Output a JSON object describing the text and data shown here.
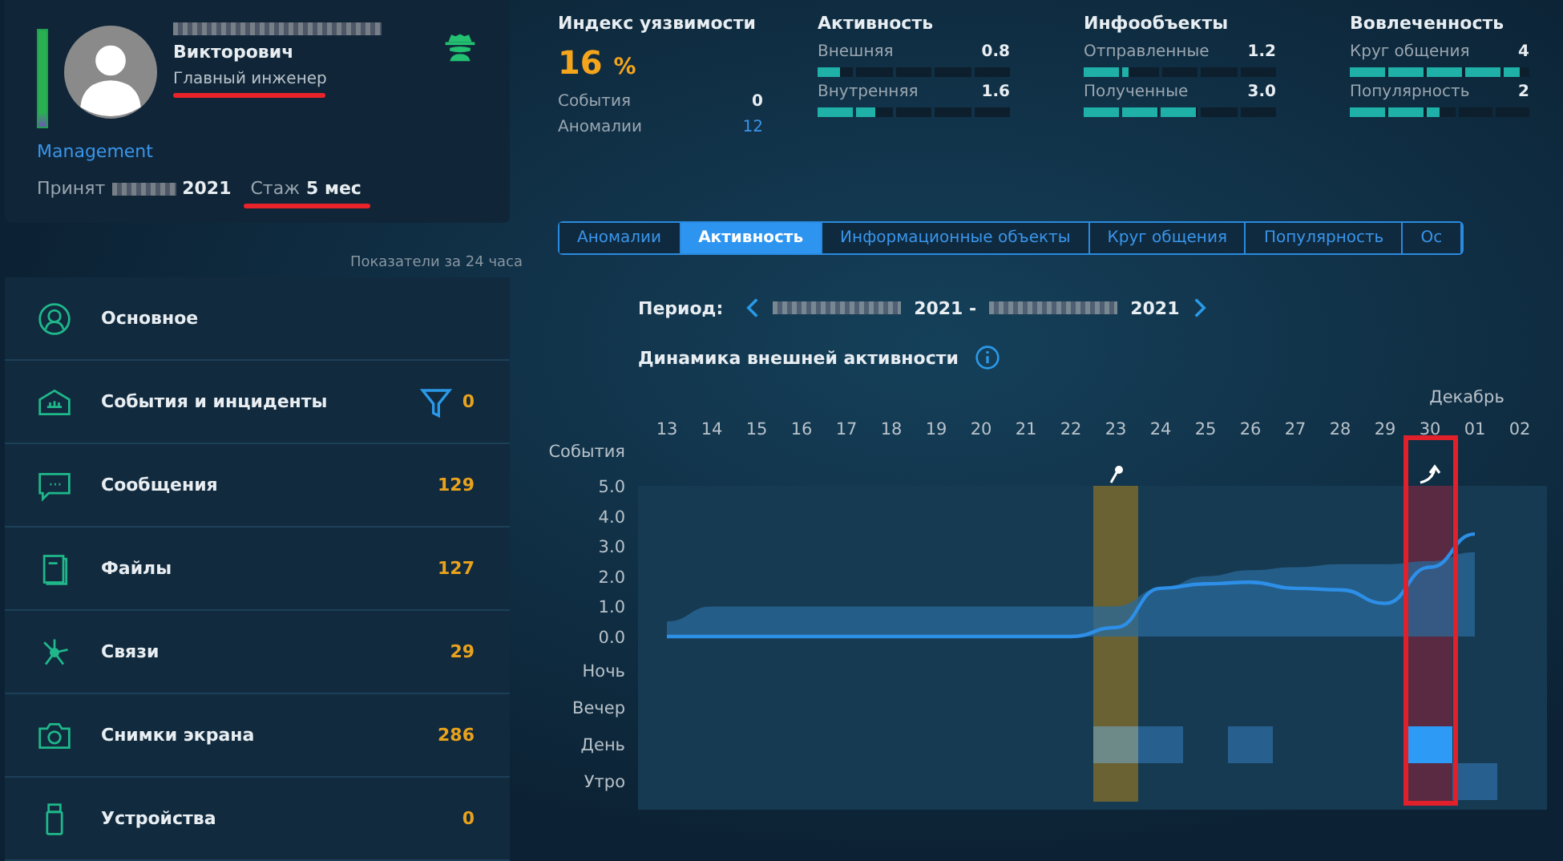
{
  "profile": {
    "name": "Викторович",
    "position": "Главный инженер",
    "department": "Management",
    "hired_label": "Принят",
    "hired_year": "2021",
    "tenure_label": "Стаж",
    "tenure_value": "5 мес"
  },
  "period_note": "Показатели за 24 часа",
  "sidebar": {
    "items": [
      {
        "kind": "person",
        "label": "Основное"
      },
      {
        "kind": "incidents",
        "label": "События и инциденты",
        "count": "0",
        "filter": true
      },
      {
        "kind": "messages",
        "label": "Сообщения",
        "count": "129"
      },
      {
        "kind": "files",
        "label": "Файлы",
        "count": "127"
      },
      {
        "kind": "links",
        "label": "Связи",
        "count": "29"
      },
      {
        "kind": "screenshots",
        "label": "Снимки экрана",
        "count": "286"
      },
      {
        "kind": "devices",
        "label": "Устройства",
        "count": "0"
      }
    ]
  },
  "vulnerability": {
    "title": "Индекс уязвимости",
    "value": "16",
    "unit": "%",
    "rows": [
      {
        "label": "События",
        "value": "0",
        "kind": "plain"
      },
      {
        "label": "Аномалии",
        "value": "12",
        "kind": "link"
      }
    ]
  },
  "metric_groups": [
    {
      "title": "Активность",
      "metrics": [
        {
          "label": "Внешняя",
          "value": "0.8",
          "level": 0.12
        },
        {
          "label": "Внутренняя",
          "value": "1.6",
          "level": 0.3
        }
      ]
    },
    {
      "title": "Инфообъекты",
      "metrics": [
        {
          "label": "Отправленные",
          "value": "1.2",
          "level": 0.23
        },
        {
          "label": "Полученные",
          "value": "3.0",
          "level": 0.6
        }
      ]
    },
    {
      "title": "Вовлеченность",
      "metrics": [
        {
          "label": "Круг общения",
          "value": "4",
          "level": 0.95
        },
        {
          "label": "Популярность",
          "value": "2",
          "level": 0.5
        }
      ]
    }
  ],
  "tabs": [
    {
      "label": "Аномалии",
      "selected": false
    },
    {
      "label": "Активность",
      "selected": true
    },
    {
      "label": "Информационные объекты",
      "selected": false
    },
    {
      "label": "Круг общения",
      "selected": false
    },
    {
      "label": "Популярность",
      "selected": false
    },
    {
      "label": "Ос",
      "selected": false
    }
  ],
  "period": {
    "label": "Период:",
    "start_year": "2021 -",
    "end_year": "2021"
  },
  "chart": {
    "title": "Динамика внешней активности",
    "month": "Декабрь",
    "row_labels": [
      "Ночь",
      "Вечер",
      "День",
      "Утро"
    ],
    "chart_data": {
      "type": "line",
      "ylabel": "События",
      "categories": [
        "13",
        "14",
        "15",
        "16",
        "17",
        "18",
        "19",
        "20",
        "21",
        "22",
        "23",
        "24",
        "25",
        "26",
        "27",
        "28",
        "29",
        "30",
        "01",
        "02"
      ],
      "yticks": [
        {
          "value": 0,
          "label": "0.0"
        },
        {
          "value": 1,
          "label": "1.0"
        },
        {
          "value": 2,
          "label": "2.0"
        },
        {
          "value": 3,
          "label": "3.0"
        },
        {
          "value": 4,
          "label": "4.0"
        },
        {
          "value": 5,
          "label": "5.0"
        }
      ],
      "ylim": [
        0,
        5
      ],
      "series": [
        {
          "type": "area",
          "color": "#2a6a9a",
          "values": [
            0.5,
            1.0,
            1.0,
            1.0,
            1.0,
            1.0,
            1.0,
            1.0,
            1.0,
            1.0,
            1.0,
            1.6,
            2.0,
            2.2,
            2.3,
            2.4,
            2.4,
            2.5,
            2.8,
            null
          ]
        },
        {
          "type": "line",
          "color": "#2d8fe8",
          "values": [
            0,
            0,
            0,
            0,
            0,
            0,
            0,
            0,
            0,
            0,
            0.3,
            1.6,
            1.75,
            1.8,
            1.6,
            1.55,
            1.1,
            2.3,
            3.4,
            null
          ]
        }
      ]
    },
    "columns": [
      {},
      {},
      {},
      {},
      {},
      {},
      {},
      {},
      {},
      {},
      {
        "highlight": {
          "kind": "star",
          "color": "#6a6233"
        },
        "cells": [
          null,
          null,
          {
            "color": "#6e8a88"
          },
          null
        ]
      },
      {
        "cells": [
          null,
          null,
          {
            "color": "#27608e"
          },
          null
        ]
      },
      {},
      {
        "cells": [
          null,
          null,
          {
            "color": "#27608e"
          },
          null
        ]
      },
      {},
      {},
      {},
      {
        "highlight": {
          "kind": "arrow",
          "color": "#5a2a42"
        },
        "cells": [
          null,
          null,
          {
            "color": "#2d9af5"
          },
          null
        ]
      },
      {
        "cells": [
          null,
          null,
          null,
          {
            "color": "#27608e"
          }
        ]
      },
      {}
    ]
  }
}
